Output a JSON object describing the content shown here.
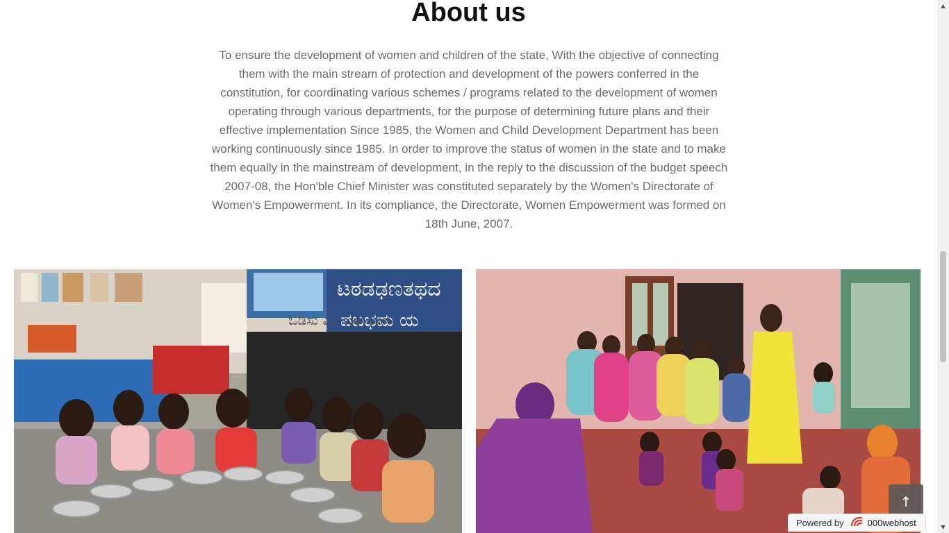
{
  "about": {
    "title": "About us",
    "text": "To ensure the development of women and children of the state, With the objective of connecting them with the main stream of protection and development of the powers conferred in the constitution, for coordinating various schemes / programs related to the development of women operating through various departments, for the purpose of determining future plans and their effective implementation Since 1985, the Women and Child Development Department has been working continuously since 1985. In order to improve the status of women in the state and to make them equally in the mainstream of development, in the reply to the discussion of the budget speech 2007-08, the Hon'ble Chief Minister was constituted separately by the Women's Directorate of Women's Empowerment. In its compliance, the Directorate, Women Empowerment was formed on 18th June, 2007."
  },
  "gallery": {
    "left_blackboard_text": "ಟಠಡಢಣತಥದ",
    "left_blackboard_text2": "ಪಬಭಮ ಯ",
    "left_wall_text": "ಓಡಿಸು  ಎಳ  ಬೆಲೆ  ಅಂಗ"
  },
  "back_to_top": {
    "icon": "arrow-up-icon",
    "glyph": "↑"
  },
  "powered_by": {
    "label": "Powered by",
    "brand": "000webhost",
    "brand_color": "#e3342f"
  },
  "scrollbar": {
    "up": "▲",
    "down": "▼"
  }
}
